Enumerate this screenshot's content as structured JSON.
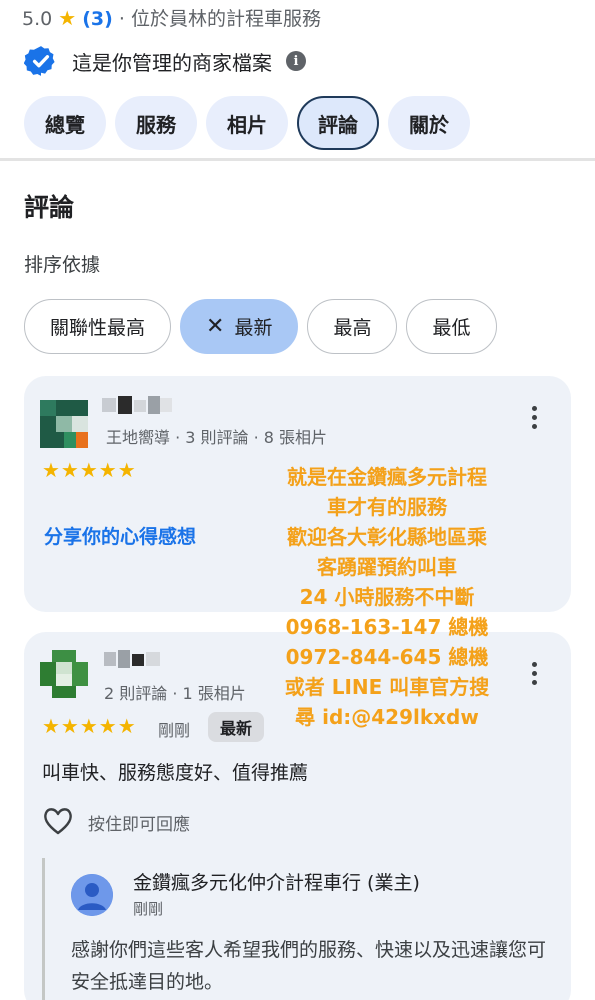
{
  "header": {
    "rating": "5.0",
    "star": "★",
    "count": "(3)",
    "separator": "·",
    "subtitle": "位於員林的計程車服務",
    "verified_text": "這是你管理的商家檔案",
    "info_glyph": "i"
  },
  "tabs": [
    "總覽",
    "服務",
    "相片",
    "評論",
    "關於"
  ],
  "active_tab": "評論",
  "reviews_section": {
    "title": "評論",
    "sort_label": "排序依據",
    "chips": [
      {
        "label": "關聯性最高",
        "selected": false
      },
      {
        "label": "最新",
        "selected": true,
        "close_glyph": "✕"
      },
      {
        "label": "最高",
        "selected": false
      },
      {
        "label": "最低",
        "selected": false
      }
    ]
  },
  "review1": {
    "meta": "王地嚮導 · 3 則評論 · 8 張相片",
    "stars": "★★★★★",
    "rating": 5,
    "share_link": "分享你的心得感想"
  },
  "overlay_ad": [
    "就是在金鑽瘋多元計程",
    "車才有的服務",
    "歡迎各大彰化縣地區乘",
    "客踴躍預約叫車",
    "24 小時服務不中斷",
    "0968-163-147 總機",
    "0972-844-645 總機",
    "或者 LINE 叫車官方搜",
    "尋 id:@429lkxdw"
  ],
  "review2": {
    "meta": "2 則評論 · 1 張相片",
    "stars": "★★★★★",
    "rating": 5,
    "time": "剛剛",
    "badge": "最新",
    "text": "叫車快、服務態度好、值得推薦",
    "reply_hint": "按住即可回應",
    "owner_reply": {
      "name": "金鑽瘋多元化仲介計程車行 (業主)",
      "time": "剛剛",
      "text": "感謝你們這些客人希望我們的服務、快速以及迅速讓您可安全抵達目的地。"
    }
  },
  "colors": {
    "star": "#f4b400",
    "link": "#1a73e8",
    "tab_bg": "#e8eefc",
    "chip_selected": "#a9c8f5",
    "card_bg": "#eef2f8",
    "overlay_text": "#f4a11a",
    "verified_badge": "#1a73e8"
  },
  "icons": {
    "verified": "verified-badge-icon",
    "info": "info-icon",
    "more": "more-vert-icon",
    "like": "heart-icon",
    "close": "close-icon",
    "owner_avatar": "person-avatar-icon"
  }
}
